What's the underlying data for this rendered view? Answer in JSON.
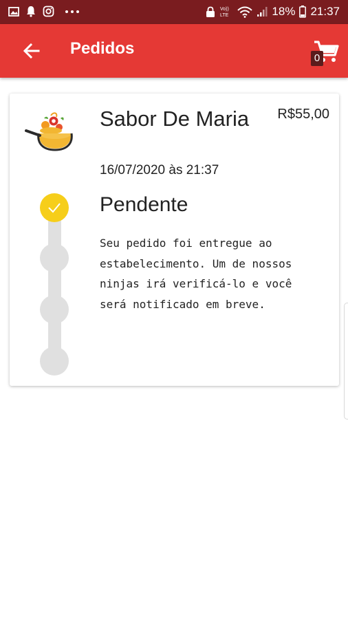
{
  "status_bar": {
    "battery": "18%",
    "time": "21:37",
    "network_label": "Vo))\nLTE",
    "icons": [
      "image-icon",
      "notification-icon",
      "instagram-icon",
      "more-icon",
      "lock-icon",
      "volte-icon",
      "wifi-icon",
      "signal-icon",
      "battery-icon"
    ]
  },
  "app_bar": {
    "title": "Pedidos",
    "back_icon": "arrow-left-icon",
    "cart_icon": "cart-icon",
    "cart_count": "0",
    "color": "#e53935"
  },
  "order": {
    "store_name": "Sabor De Maria",
    "price": "R$55,00",
    "datetime": "16/07/2020 às 21:37",
    "status": "Pendente",
    "description": "Seu pedido foi entregue ao estabelecimento. Um de nossos ninjas irá verificá-lo e você será notificado em breve.",
    "steps_total": 4,
    "steps_completed": 1,
    "accent_color": "#f6ce1a"
  }
}
